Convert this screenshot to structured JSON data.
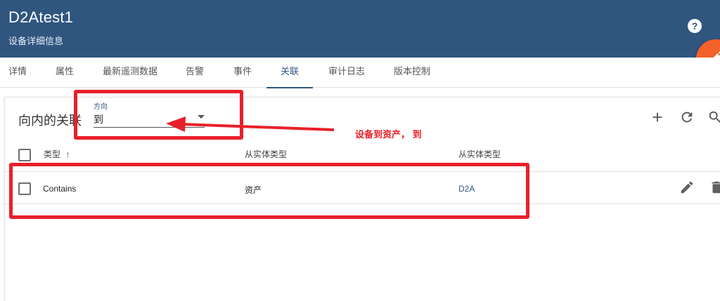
{
  "header": {
    "title": "D2Atest1",
    "subtitle": "设备详细信息",
    "help_glyph": "?"
  },
  "tabs": [
    {
      "label": "详情"
    },
    {
      "label": "属性"
    },
    {
      "label": "最新遥测数据"
    },
    {
      "label": "告警"
    },
    {
      "label": "事件"
    },
    {
      "label": "关联",
      "active": true
    },
    {
      "label": "审计日志"
    },
    {
      "label": "版本控制"
    }
  ],
  "relations": {
    "title": "向内的关联",
    "direction": {
      "label": "方向",
      "value": "到"
    },
    "toolbar": {
      "add_icon": "plus-icon",
      "refresh_icon": "refresh-icon",
      "search_icon": "search-icon"
    },
    "columns": [
      {
        "label": "类型",
        "sort": "↑"
      },
      {
        "label": "从实体类型"
      },
      {
        "label": "从实体类型"
      }
    ],
    "rows": [
      {
        "type": "Contains",
        "entity_type": "资产",
        "entity_name": "D2A"
      }
    ]
  },
  "annotation": {
    "text": "设备到资产， 到",
    "color": "#e8202a"
  },
  "colors": {
    "header": "#305680",
    "accent": "#f4612a",
    "link": "#305680"
  }
}
